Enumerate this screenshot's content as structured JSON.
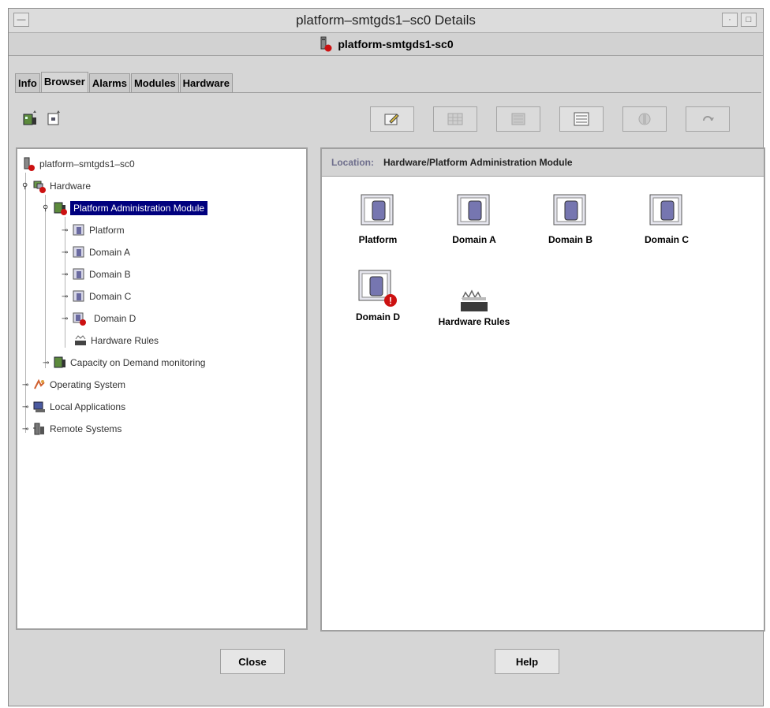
{
  "window": {
    "title": "platform–smtgds1–sc0 Details",
    "header_label": "platform-smtgds1-sc0"
  },
  "tabs": [
    {
      "label": "Info"
    },
    {
      "label": "Browser",
      "active": true
    },
    {
      "label": "Alarms"
    },
    {
      "label": "Modules"
    },
    {
      "label": "Hardware"
    }
  ],
  "toolbar": {
    "left_icons": [
      "new-object-icon",
      "properties-icon"
    ],
    "right_buttons": [
      {
        "icon": "edit-icon",
        "enabled": true
      },
      {
        "icon": "table-icon",
        "enabled": false
      },
      {
        "icon": "graph-icon",
        "enabled": false
      },
      {
        "icon": "list-view-icon",
        "enabled": true
      },
      {
        "icon": "probe-icon",
        "enabled": false
      },
      {
        "icon": "refresh-icon",
        "enabled": false
      }
    ]
  },
  "tree": {
    "root": "platform–smtgds1–sc0",
    "hardware": "Hardware",
    "pam": "Platform Administration Module",
    "platform": "Platform",
    "domain_a": "Domain A",
    "domain_b": "Domain B",
    "domain_c": "Domain C",
    "domain_d": "Domain D",
    "hardware_rules": "Hardware Rules",
    "capacity": "Capacity on Demand monitoring",
    "os": "Operating System",
    "local_apps": "Local Applications",
    "remote": "Remote Systems"
  },
  "location": {
    "label": "Location:",
    "value": "Hardware/Platform Administration Module"
  },
  "content_items": [
    {
      "label": "Platform",
      "alarm": false
    },
    {
      "label": "Domain A",
      "alarm": false
    },
    {
      "label": "Domain B",
      "alarm": false
    },
    {
      "label": "Domain C",
      "alarm": false
    },
    {
      "label": "Domain D",
      "alarm": true,
      "alarm_text": "!"
    },
    {
      "label": "Hardware Rules",
      "alarm": false
    }
  ],
  "buttons": {
    "close": "Close",
    "help": "Help"
  },
  "colors": {
    "selection": "#00007e",
    "alarm": "#cc1111",
    "location_label": "#6e6e8c"
  }
}
